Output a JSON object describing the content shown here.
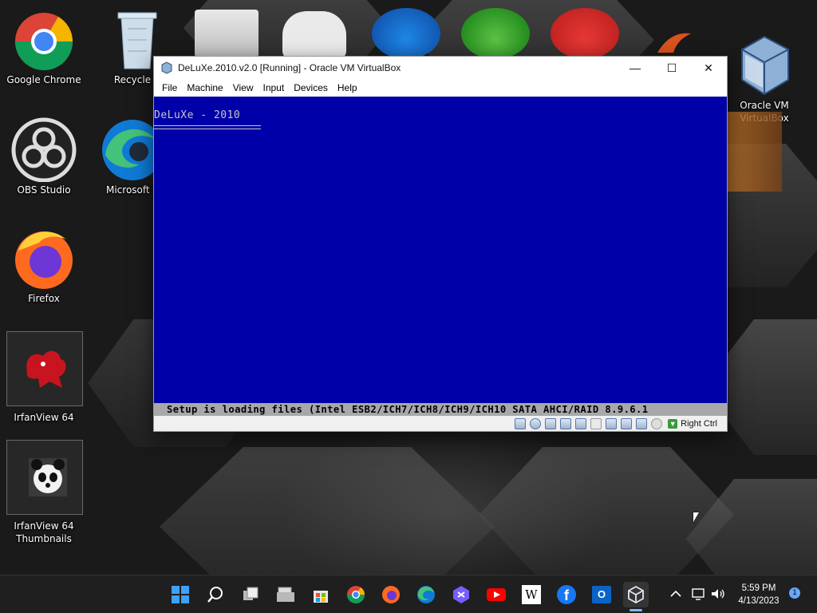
{
  "desktop": {
    "icons": [
      {
        "label": "Google Chrome"
      },
      {
        "label": "Recycle B"
      },
      {
        "label": "OBS Studio"
      },
      {
        "label": "Microsoft E"
      },
      {
        "label": "Firefox"
      },
      {
        "label": "IrfanView 64"
      },
      {
        "label": "IrfanView 64\nThumbnails"
      },
      {
        "label": "Oracle VM\nVirtualBox"
      }
    ]
  },
  "window": {
    "title": "DeLuXe.2010.v2.0 [Running] - Oracle VM VirtualBox",
    "menu": [
      "File",
      "Machine",
      "View",
      "Input",
      "Devices",
      "Help"
    ],
    "controls": {
      "minimize": "—",
      "maximize": "☐",
      "close": "✕"
    }
  },
  "guest": {
    "title": "DeLuXe - 2010",
    "status_line": "Setup is loading files (Intel ESB2/ICH7/ICH8/ICH9/ICH10 SATA AHCI/RAID 8.9.6.1",
    "background_color": "#0000a8"
  },
  "statusbar": {
    "host_key": "Right Ctrl"
  },
  "taskbar": {
    "apps": [
      "start-icon",
      "search-icon",
      "task-view-icon",
      "file-explorer-icon",
      "store-icon",
      "chrome-icon",
      "firefox-icon",
      "edge-icon",
      "dev-icon",
      "youtube-icon",
      "wikipedia-icon",
      "facebook-icon",
      "outlook-icon",
      "virtualbox-icon"
    ],
    "wikipedia_glyph": "W",
    "facebook_glyph": "f",
    "outlook_glyph": "O",
    "time": "5:59 PM",
    "date": "4/13/2023",
    "notification_count": "1"
  }
}
